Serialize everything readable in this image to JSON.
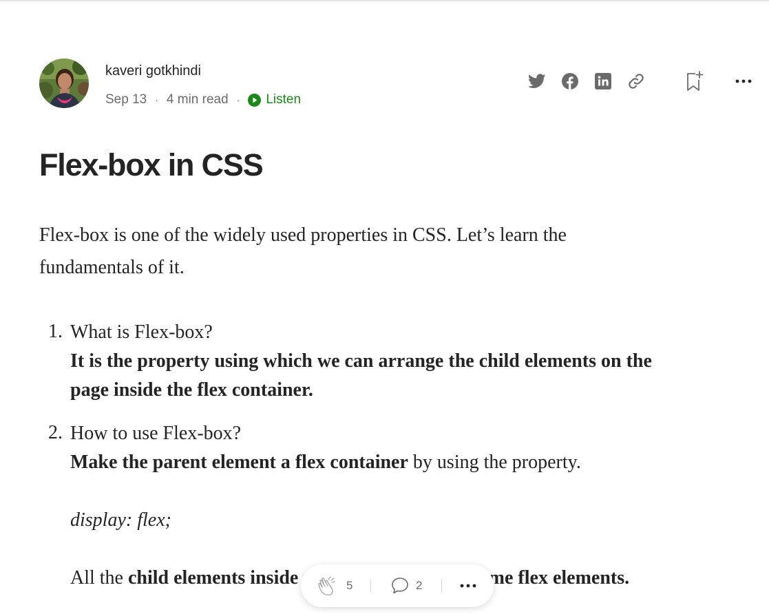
{
  "author": {
    "name": "kaveri gotkhindi",
    "date": "Sep 13",
    "read_time": "4 min read",
    "separator": "·",
    "listen_label": "Listen"
  },
  "share_icons": [
    "twitter-icon",
    "facebook-icon",
    "linkedin-icon",
    "link-icon",
    "bookmark-add-icon",
    "more-icon"
  ],
  "article": {
    "title": "Flex-box in CSS",
    "intro_line1": "Flex-box is one of the widely used properties in CSS. Let’s learn the",
    "intro_line2": "fundamentals of it.",
    "items": [
      {
        "number": "1.",
        "question": "What is Flex-box?",
        "answer_line1": "It is the property using which we can arrange the child elements on the",
        "answer_line2": "page inside the flex container."
      },
      {
        "number": "2.",
        "question": "How to use Flex-box?",
        "answer_bold": "Make the parent element a flex container",
        "answer_rest": " by using the property.",
        "code": "display: flex;",
        "note_start": "All the ",
        "note_bold_1": "child elements ins",
        "note_hidden": "ide the flex containe",
        "note_bold_2": "r become flex elements."
      }
    ]
  },
  "clap_bar": {
    "claps": "5",
    "responses": "2",
    "icons": [
      "clap-icon",
      "comment-icon",
      "more-icon"
    ]
  },
  "colors": {
    "text": "#242424",
    "meta": "#6b6b6b",
    "icon": "#6b6b6b",
    "listen": "#1a8917"
  }
}
